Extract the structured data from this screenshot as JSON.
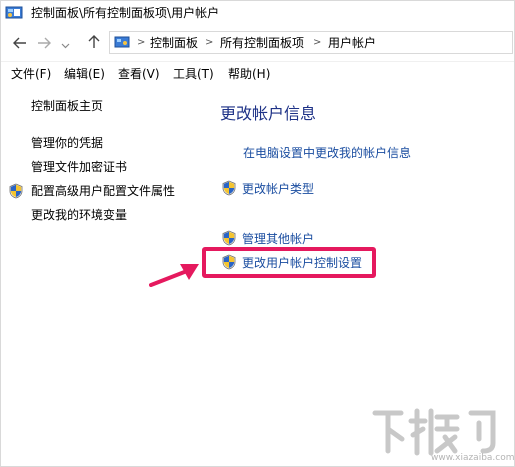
{
  "window": {
    "title": "控制面板\\所有控制面板项\\用户帐户"
  },
  "address_bar": {
    "crumbs": [
      "控制面板",
      "所有控制面板项",
      "用户帐户"
    ],
    "separator": ">"
  },
  "menu": {
    "items": [
      "文件(F)",
      "编辑(E)",
      "查看(V)",
      "工具(T)",
      "帮助(H)"
    ]
  },
  "left_pane": {
    "home": "控制面板主页",
    "links": [
      "管理你的凭据",
      "管理文件加密证书",
      "配置高级用户配置文件属性",
      "更改我的环境变量"
    ]
  },
  "main": {
    "heading": "更改帐户信息",
    "links": [
      "在电脑设置中更改我的帐户信息",
      "更改帐户类型",
      "管理其他帐户",
      "更改用户帐户控制设置"
    ]
  },
  "annotation": {
    "highlight_color": "#e5195e"
  },
  "watermark": {
    "site": "www.xiazaiba.com"
  }
}
